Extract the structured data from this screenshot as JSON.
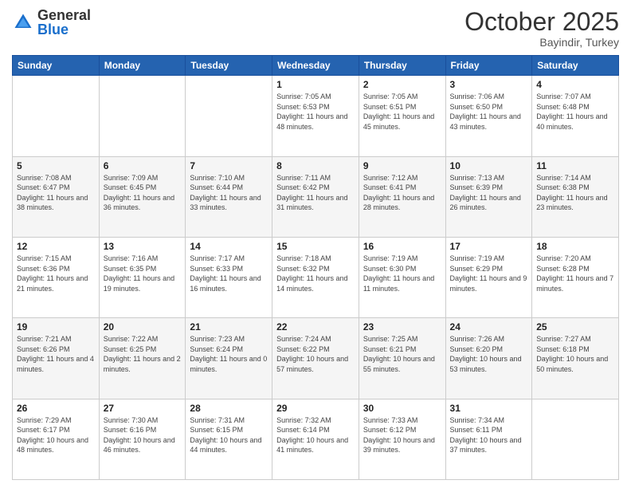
{
  "logo": {
    "general": "General",
    "blue": "Blue"
  },
  "header": {
    "month": "October 2025",
    "location": "Bayindir, Turkey"
  },
  "days_of_week": [
    "Sunday",
    "Monday",
    "Tuesday",
    "Wednesday",
    "Thursday",
    "Friday",
    "Saturday"
  ],
  "weeks": [
    [
      {
        "day": "",
        "info": ""
      },
      {
        "day": "",
        "info": ""
      },
      {
        "day": "",
        "info": ""
      },
      {
        "day": "1",
        "info": "Sunrise: 7:05 AM\nSunset: 6:53 PM\nDaylight: 11 hours and 48 minutes."
      },
      {
        "day": "2",
        "info": "Sunrise: 7:05 AM\nSunset: 6:51 PM\nDaylight: 11 hours and 45 minutes."
      },
      {
        "day": "3",
        "info": "Sunrise: 7:06 AM\nSunset: 6:50 PM\nDaylight: 11 hours and 43 minutes."
      },
      {
        "day": "4",
        "info": "Sunrise: 7:07 AM\nSunset: 6:48 PM\nDaylight: 11 hours and 40 minutes."
      }
    ],
    [
      {
        "day": "5",
        "info": "Sunrise: 7:08 AM\nSunset: 6:47 PM\nDaylight: 11 hours and 38 minutes."
      },
      {
        "day": "6",
        "info": "Sunrise: 7:09 AM\nSunset: 6:45 PM\nDaylight: 11 hours and 36 minutes."
      },
      {
        "day": "7",
        "info": "Sunrise: 7:10 AM\nSunset: 6:44 PM\nDaylight: 11 hours and 33 minutes."
      },
      {
        "day": "8",
        "info": "Sunrise: 7:11 AM\nSunset: 6:42 PM\nDaylight: 11 hours and 31 minutes."
      },
      {
        "day": "9",
        "info": "Sunrise: 7:12 AM\nSunset: 6:41 PM\nDaylight: 11 hours and 28 minutes."
      },
      {
        "day": "10",
        "info": "Sunrise: 7:13 AM\nSunset: 6:39 PM\nDaylight: 11 hours and 26 minutes."
      },
      {
        "day": "11",
        "info": "Sunrise: 7:14 AM\nSunset: 6:38 PM\nDaylight: 11 hours and 23 minutes."
      }
    ],
    [
      {
        "day": "12",
        "info": "Sunrise: 7:15 AM\nSunset: 6:36 PM\nDaylight: 11 hours and 21 minutes."
      },
      {
        "day": "13",
        "info": "Sunrise: 7:16 AM\nSunset: 6:35 PM\nDaylight: 11 hours and 19 minutes."
      },
      {
        "day": "14",
        "info": "Sunrise: 7:17 AM\nSunset: 6:33 PM\nDaylight: 11 hours and 16 minutes."
      },
      {
        "day": "15",
        "info": "Sunrise: 7:18 AM\nSunset: 6:32 PM\nDaylight: 11 hours and 14 minutes."
      },
      {
        "day": "16",
        "info": "Sunrise: 7:19 AM\nSunset: 6:30 PM\nDaylight: 11 hours and 11 minutes."
      },
      {
        "day": "17",
        "info": "Sunrise: 7:19 AM\nSunset: 6:29 PM\nDaylight: 11 hours and 9 minutes."
      },
      {
        "day": "18",
        "info": "Sunrise: 7:20 AM\nSunset: 6:28 PM\nDaylight: 11 hours and 7 minutes."
      }
    ],
    [
      {
        "day": "19",
        "info": "Sunrise: 7:21 AM\nSunset: 6:26 PM\nDaylight: 11 hours and 4 minutes."
      },
      {
        "day": "20",
        "info": "Sunrise: 7:22 AM\nSunset: 6:25 PM\nDaylight: 11 hours and 2 minutes."
      },
      {
        "day": "21",
        "info": "Sunrise: 7:23 AM\nSunset: 6:24 PM\nDaylight: 11 hours and 0 minutes."
      },
      {
        "day": "22",
        "info": "Sunrise: 7:24 AM\nSunset: 6:22 PM\nDaylight: 10 hours and 57 minutes."
      },
      {
        "day": "23",
        "info": "Sunrise: 7:25 AM\nSunset: 6:21 PM\nDaylight: 10 hours and 55 minutes."
      },
      {
        "day": "24",
        "info": "Sunrise: 7:26 AM\nSunset: 6:20 PM\nDaylight: 10 hours and 53 minutes."
      },
      {
        "day": "25",
        "info": "Sunrise: 7:27 AM\nSunset: 6:18 PM\nDaylight: 10 hours and 50 minutes."
      }
    ],
    [
      {
        "day": "26",
        "info": "Sunrise: 7:29 AM\nSunset: 6:17 PM\nDaylight: 10 hours and 48 minutes."
      },
      {
        "day": "27",
        "info": "Sunrise: 7:30 AM\nSunset: 6:16 PM\nDaylight: 10 hours and 46 minutes."
      },
      {
        "day": "28",
        "info": "Sunrise: 7:31 AM\nSunset: 6:15 PM\nDaylight: 10 hours and 44 minutes."
      },
      {
        "day": "29",
        "info": "Sunrise: 7:32 AM\nSunset: 6:14 PM\nDaylight: 10 hours and 41 minutes."
      },
      {
        "day": "30",
        "info": "Sunrise: 7:33 AM\nSunset: 6:12 PM\nDaylight: 10 hours and 39 minutes."
      },
      {
        "day": "31",
        "info": "Sunrise: 7:34 AM\nSunset: 6:11 PM\nDaylight: 10 hours and 37 minutes."
      },
      {
        "day": "",
        "info": ""
      }
    ]
  ]
}
